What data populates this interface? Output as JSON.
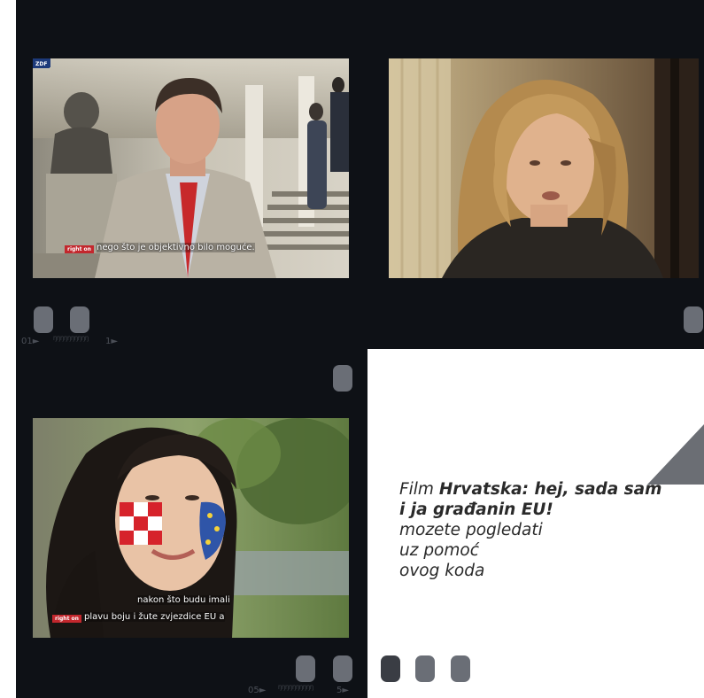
{
  "frames": {
    "top_left": {
      "channel_tag": "ZDF",
      "subtitle_logo": "right on",
      "subtitle": "nego što je objektivno bilo moguće."
    },
    "bottom_left": {
      "subtitle_logo": "right on",
      "subtitle_line1": "nakon što budu imali",
      "subtitle_line2": "plavu boju i žute zvjezdice EU a"
    }
  },
  "film_numbers": {
    "top_left_number": "01►",
    "top_microtext": "ŊŊŊŊŊŊŊŊŊŊ",
    "top_right_number": "1►",
    "bottom_left_number": "05►",
    "bottom_microtext": "ŊŊŊŊŊŊŊŊŊŊ",
    "bottom_right_number": "5►"
  },
  "caption": {
    "prefix": "Film ",
    "title": "Hrvatska: hej, sada sam i ja građanin EU!",
    "line2": "mozete pogledati",
    "line3": "uz pomoć",
    "line4": "ovog koda"
  },
  "colors": {
    "film_background": "#0e1116",
    "sprocket": "#6a6e76",
    "triangle": "#6b6e74",
    "caption_text": "#2a2a2a"
  }
}
